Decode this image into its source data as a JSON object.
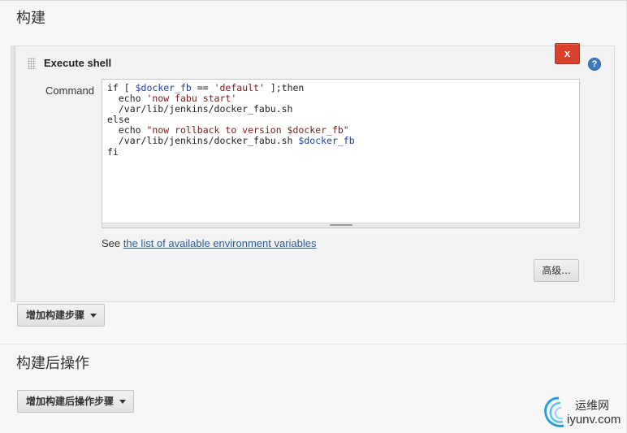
{
  "sections": {
    "build_title": "构建",
    "post_build_title": "构建后操作"
  },
  "execute_shell": {
    "title": "Execute shell",
    "delete_label": "x",
    "help_label": "?",
    "command_label": "Command",
    "command_lines": [
      "if [ $docker_fb == 'default' ];then",
      "  echo 'now fabu start'",
      "  /var/lib/jenkins/docker_fabu.sh",
      "else",
      "  echo \"now rollback to version $docker_fb\"",
      "  /var/lib/jenkins/docker_fabu.sh $docker_fb",
      "fi"
    ],
    "see_prefix": "See ",
    "env_link": "the list of available environment variables",
    "advanced_label": "高级..."
  },
  "buttons": {
    "add_build_step": "增加构建步骤",
    "add_post_build_step": "增加构建后操作步骤"
  },
  "watermark": {
    "cn": "运维网",
    "en": "iyunv.com"
  }
}
